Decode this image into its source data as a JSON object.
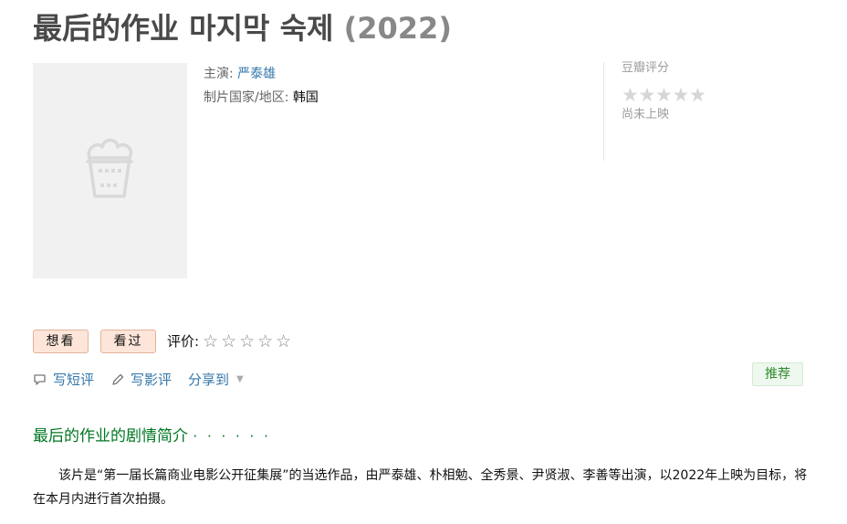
{
  "title": {
    "name": "最后的作业 마지막 숙제",
    "year": "(2022)"
  },
  "poster": {
    "icon": "popcorn-placeholder-icon"
  },
  "info": {
    "cast_label": "主演:",
    "cast_value": "严泰雄",
    "country_label": "制片国家/地区:",
    "country_value": "韩国"
  },
  "rating": {
    "label": "豆瓣评分",
    "stars": "★★★★★",
    "status": "尚未上映"
  },
  "buttons": {
    "want": "想看",
    "seen": "看过"
  },
  "rate": {
    "label": "评价:",
    "stars": "☆☆☆☆☆"
  },
  "actions": {
    "short_review": "写短评",
    "review": "写影评",
    "share": "分享到",
    "share_caret": "▼"
  },
  "recommend": "推荐",
  "section": {
    "title": "最后的作业的剧情简介",
    "dots": "· · · · · ·"
  },
  "summary": "该片是“第一届长篇商业电影公开征集展”的当选作品，由严泰雄、朴相勉、全秀景、尹贤淑、李善等出演，以2022年上映为目标，将在本月内进行首次拍摄。",
  "colors": {
    "link": "#3377aa",
    "section_green": "#007722",
    "button_bg": "#fde6d9",
    "recommend_bg": "#eef8ee"
  }
}
